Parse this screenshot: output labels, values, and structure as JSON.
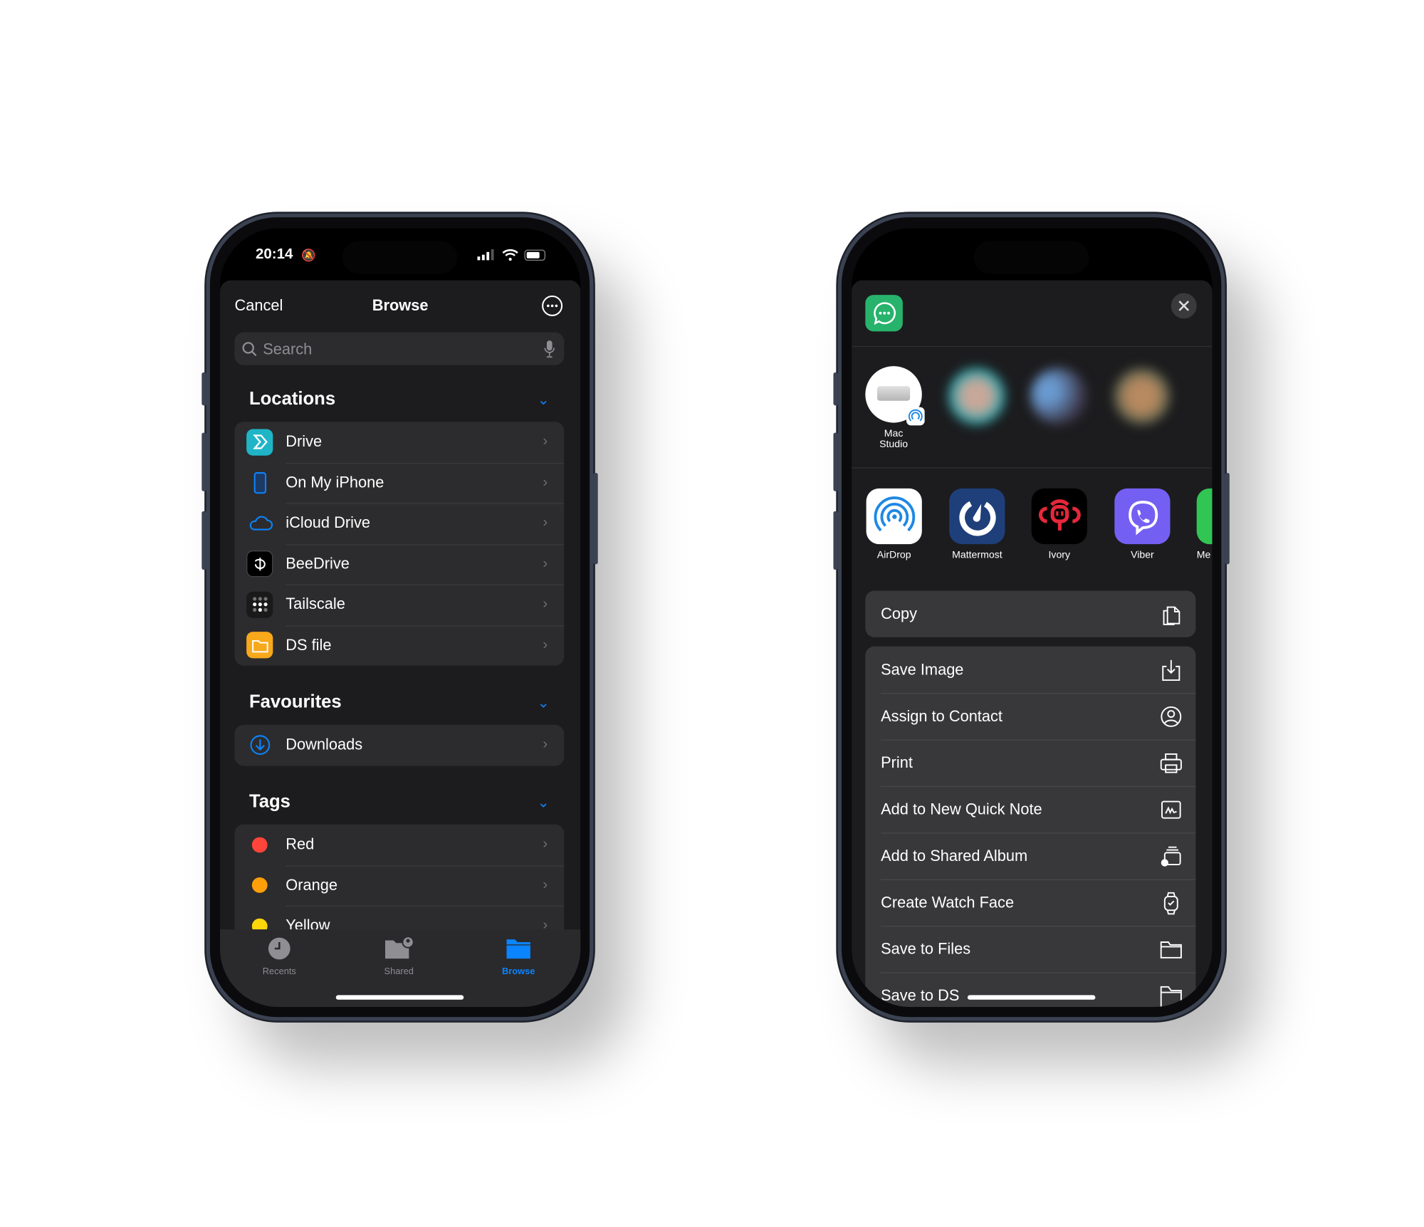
{
  "left_phone": {
    "status": {
      "time": "20:14"
    },
    "nav": {
      "cancel": "Cancel",
      "title": "Browse"
    },
    "search": {
      "placeholder": "Search"
    },
    "locations": {
      "title": "Locations",
      "items": [
        {
          "label": "Drive",
          "icon": "synology-drive-icon"
        },
        {
          "label": "On My iPhone",
          "icon": "iphone-icon"
        },
        {
          "label": "iCloud Drive",
          "icon": "cloud-icon"
        },
        {
          "label": "BeeDrive",
          "icon": "beedrive-icon"
        },
        {
          "label": "Tailscale",
          "icon": "tailscale-icon"
        },
        {
          "label": "DS file",
          "icon": "folder-icon"
        }
      ]
    },
    "favourites": {
      "title": "Favourites",
      "items": [
        {
          "label": "Downloads",
          "icon": "download-icon"
        }
      ]
    },
    "tags": {
      "title": "Tags",
      "items": [
        {
          "label": "Red",
          "color": "#ff453a"
        },
        {
          "label": "Orange",
          "color": "#ff9f0a"
        },
        {
          "label": "Yellow",
          "color": "#ffd60a"
        }
      ]
    },
    "tabbar": {
      "tabs": [
        {
          "label": "Recents"
        },
        {
          "label": "Shared"
        },
        {
          "label": "Browse",
          "active": true
        }
      ],
      "accent": "#0a84ff"
    }
  },
  "right_phone": {
    "people": [
      {
        "label_line1": "Mac",
        "label_line2": "Studio"
      }
    ],
    "apps": [
      {
        "label": "AirDrop"
      },
      {
        "label": "Mattermost"
      },
      {
        "label": "Ivory"
      },
      {
        "label": "Viber"
      },
      {
        "label": "Me"
      }
    ],
    "actions_top": [
      {
        "label": "Copy",
        "icon": "copy-icon"
      }
    ],
    "actions": [
      {
        "label": "Save Image",
        "icon": "save-icon"
      },
      {
        "label": "Assign to Contact",
        "icon": "contact-icon"
      },
      {
        "label": "Print",
        "icon": "printer-icon"
      },
      {
        "label": "Add to New Quick Note",
        "icon": "quick-note-icon"
      },
      {
        "label": "Add to Shared Album",
        "icon": "shared-album-icon"
      },
      {
        "label": "Create Watch Face",
        "icon": "watch-icon"
      },
      {
        "label": "Save to Files",
        "icon": "folder-icon"
      },
      {
        "label": "Save to DS",
        "icon": "folder-icon"
      }
    ]
  }
}
